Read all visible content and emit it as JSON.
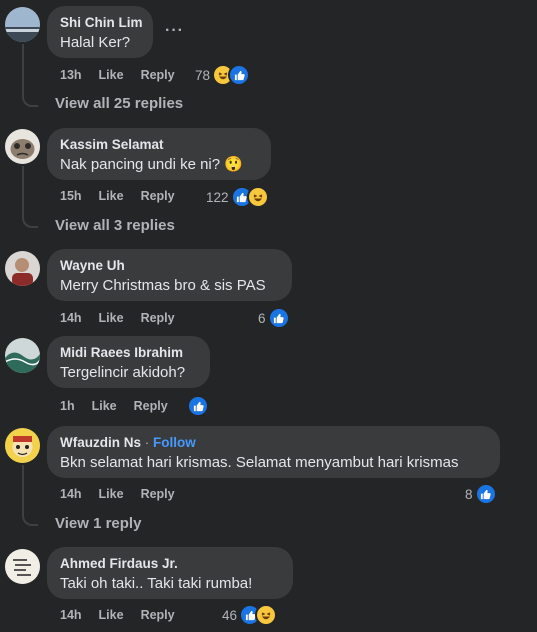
{
  "comments": [
    {
      "name": "Shi Chin Lim",
      "text": "Halal Ker?",
      "time": "13h",
      "like": "Like",
      "reply": "Reply",
      "reaction_count": "78",
      "reactions": [
        "haha-icon",
        "like-icon"
      ],
      "view_replies": "View all 25 replies"
    },
    {
      "name": "Kassim Selamat",
      "text": "Nak pancing undi ke ni? 😲",
      "time": "15h",
      "like": "Like",
      "reply": "Reply",
      "reaction_count": "122",
      "reactions": [
        "like-icon",
        "haha-icon"
      ],
      "view_replies": "View all 3 replies"
    },
    {
      "name": "Wayne Uh",
      "text": "Merry Christmas bro & sis PAS",
      "time": "14h",
      "like": "Like",
      "reply": "Reply",
      "reaction_count": "6",
      "reactions": [
        "like-icon"
      ]
    },
    {
      "name": "Midi Raees Ibrahim",
      "text": "Tergelincir akidoh?",
      "time": "1h",
      "like": "Like",
      "reply": "Reply",
      "reaction_count": "",
      "reactions": [
        "like-icon"
      ]
    },
    {
      "name": "Wfauzdin Ns",
      "name_sep": " · ",
      "follow": "Follow",
      "text": "Bkn selamat hari krismas. Selamat menyambut hari krismas",
      "time": "14h",
      "like": "Like",
      "reply": "Reply",
      "reaction_count": "8",
      "reactions": [
        "like-icon"
      ],
      "view_replies": "View 1 reply"
    },
    {
      "name": "Ahmed Firdaus Jr.",
      "text": "Taki oh taki.. Taki taki rumba!",
      "time": "14h",
      "like": "Like",
      "reply": "Reply",
      "reaction_count": "46",
      "reactions": [
        "like-icon",
        "haha-icon"
      ]
    }
  ],
  "more_menu": "···",
  "colors": {
    "background": "#242526",
    "bubble": "#3a3b3c",
    "like_blue": "#1b74e4",
    "follow_blue": "#4599ff"
  }
}
